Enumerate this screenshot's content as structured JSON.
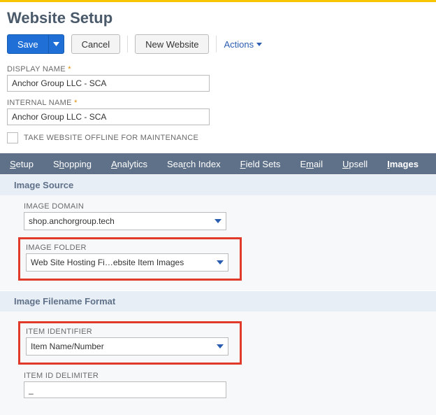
{
  "page": {
    "title": "Website Setup"
  },
  "toolbar": {
    "save": "Save",
    "cancel": "Cancel",
    "new_website": "New Website",
    "actions": "Actions"
  },
  "fields": {
    "display_name": {
      "label": "DISPLAY NAME",
      "value": "Anchor Group LLC - SCA"
    },
    "internal_name": {
      "label": "INTERNAL NAME",
      "value": "Anchor Group LLC - SCA"
    },
    "offline": {
      "label": "TAKE WEBSITE OFFLINE FOR MAINTENANCE"
    }
  },
  "tabs": [
    {
      "label": "Setup"
    },
    {
      "label": "Shopping"
    },
    {
      "label": "Analytics"
    },
    {
      "label": "Search Index"
    },
    {
      "label": "Field Sets"
    },
    {
      "label": "Email"
    },
    {
      "label": "Upsell"
    },
    {
      "label": "Images",
      "active": true
    }
  ],
  "sections": {
    "image_source": {
      "title": "Image Source",
      "image_domain": {
        "label": "IMAGE DOMAIN",
        "value": "shop.anchorgroup.tech"
      },
      "image_folder": {
        "label": "IMAGE FOLDER",
        "value": "Web Site Hosting Fi…ebsite Item Images"
      }
    },
    "filename_format": {
      "title": "Image Filename Format",
      "item_identifier": {
        "label": "ITEM IDENTIFIER",
        "value": "Item Name/Number"
      },
      "item_id_delimiter": {
        "label": "ITEM ID DELIMITER",
        "value": "_"
      }
    }
  }
}
